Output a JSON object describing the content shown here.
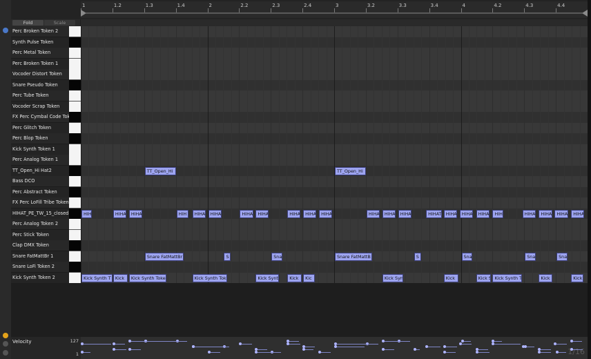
{
  "ruler": {
    "labels": [
      "1",
      "1.2",
      "1.3",
      "1.4",
      "2",
      "2.2",
      "2.3",
      "2.4",
      "3",
      "3.2",
      "3.3",
      "3.4",
      "4",
      "4.2",
      "4.3",
      "4.4"
    ]
  },
  "controls": {
    "fold_label": "Fold",
    "scale_label": "Scale"
  },
  "tracks": [
    "Perc Broken Token 2",
    "Synth Pulse Token",
    "Perc Metal Token",
    "Perc Broken Token 1",
    "Vocoder Distort Token",
    "Snare Pseudo Token",
    "Perc Tube Token",
    "Vocoder Scrap Token",
    "FX Perc Cymbal Code Toke",
    "Perc Glitch Token",
    "Perc Blop Token",
    "Kick Synth Token 1",
    "Perc Analog Token 1",
    "TT_Open_Hi Hat2",
    "Bass DCO",
    "Perc Abstract Token",
    "FX Perc LoFill Tribe Token",
    "HIHAT_PE_TW_15_closed",
    "Perc Analog Token 2",
    "Perc Stick Token",
    "Clap DMX Token",
    "Snare FatMattBr 1",
    "Snare LoFi Token 2",
    "Kick Synth Token 2"
  ],
  "notes": [
    {
      "row": 13,
      "start": 1.5,
      "len": 0.25,
      "label": "TT_Open_Hi"
    },
    {
      "row": 13,
      "start": 3.0,
      "len": 0.25,
      "label": "TT_Open_Hi"
    },
    {
      "row": 17,
      "start": 1.0,
      "len": 0.0875,
      "label": "HIH"
    },
    {
      "row": 17,
      "start": 1.25,
      "len": 0.11,
      "label": "HIHA"
    },
    {
      "row": 17,
      "start": 1.375,
      "len": 0.11,
      "label": "HIHA"
    },
    {
      "row": 17,
      "start": 1.75,
      "len": 0.1,
      "label": "HIH"
    },
    {
      "row": 17,
      "start": 1.875,
      "len": 0.11,
      "label": "HIHA"
    },
    {
      "row": 17,
      "start": 2.0,
      "len": 0.11,
      "label": "HIHA"
    },
    {
      "row": 17,
      "start": 2.25,
      "len": 0.11,
      "label": "HIHA"
    },
    {
      "row": 17,
      "start": 2.375,
      "len": 0.11,
      "label": "HIHA"
    },
    {
      "row": 17,
      "start": 2.625,
      "len": 0.11,
      "label": "HIHA"
    },
    {
      "row": 17,
      "start": 2.75,
      "len": 0.11,
      "label": "HIHA"
    },
    {
      "row": 17,
      "start": 2.875,
      "len": 0.11,
      "label": "HIHA"
    },
    {
      "row": 17,
      "start": 3.25,
      "len": 0.11,
      "label": "HIHA"
    },
    {
      "row": 17,
      "start": 3.375,
      "len": 0.11,
      "label": "HIHA"
    },
    {
      "row": 17,
      "start": 3.5,
      "len": 0.11,
      "label": "HIHA"
    },
    {
      "row": 17,
      "start": 3.72,
      "len": 0.13,
      "label": "HIHAT"
    },
    {
      "row": 17,
      "start": 3.86,
      "len": 0.11,
      "label": "HIHA"
    },
    {
      "row": 17,
      "start": 3.985,
      "len": 0.11,
      "label": "HIHA"
    },
    {
      "row": 17,
      "start": 4.115,
      "len": 0.11,
      "label": "HIHA"
    },
    {
      "row": 17,
      "start": 4.245,
      "len": 0.09,
      "label": "HIH"
    },
    {
      "row": 17,
      "start": 4.48,
      "len": 0.11,
      "label": "HIHA"
    },
    {
      "row": 17,
      "start": 4.61,
      "len": 0.11,
      "label": "HIHA"
    },
    {
      "row": 17,
      "start": 4.735,
      "len": 0.11,
      "label": "HIHA"
    },
    {
      "row": 17,
      "start": 4.865,
      "len": 0.11,
      "label": "HIHA"
    },
    {
      "row": 21,
      "start": 1.5,
      "len": 0.31,
      "label": "Snare FatMattBr"
    },
    {
      "row": 21,
      "start": 2.125,
      "len": 0.06,
      "label": "S"
    },
    {
      "row": 21,
      "start": 2.5,
      "len": 0.09,
      "label": "Sna"
    },
    {
      "row": 21,
      "start": 3.0,
      "len": 0.3,
      "label": "Snare FatMattB"
    },
    {
      "row": 21,
      "start": 3.625,
      "len": 0.06,
      "label": "S"
    },
    {
      "row": 21,
      "start": 4.0,
      "len": 0.09,
      "label": "Sna"
    },
    {
      "row": 21,
      "start": 4.5,
      "len": 0.09,
      "label": "Sna"
    },
    {
      "row": 21,
      "start": 4.75,
      "len": 0.09,
      "label": "Sna"
    },
    {
      "row": 23,
      "start": 1.0,
      "len": 0.25,
      "label": "Kick Synth T"
    },
    {
      "row": 23,
      "start": 1.25,
      "len": 0.12,
      "label": "Kick"
    },
    {
      "row": 23,
      "start": 1.375,
      "len": 0.3,
      "label": "Kick Synth Toke"
    },
    {
      "row": 23,
      "start": 1.875,
      "len": 0.28,
      "label": "Kick Synth Tok"
    },
    {
      "row": 23,
      "start": 2.375,
      "len": 0.19,
      "label": "Kick Synt"
    },
    {
      "row": 23,
      "start": 2.625,
      "len": 0.12,
      "label": "Kick"
    },
    {
      "row": 23,
      "start": 2.75,
      "len": 0.1,
      "label": "Kic"
    },
    {
      "row": 23,
      "start": 3.375,
      "len": 0.17,
      "label": "Kick Syn"
    },
    {
      "row": 23,
      "start": 3.86,
      "len": 0.12,
      "label": "Kick"
    },
    {
      "row": 23,
      "start": 4.115,
      "len": 0.12,
      "label": "Kick S"
    },
    {
      "row": 23,
      "start": 4.245,
      "len": 0.24,
      "label": "Kick Synth T"
    },
    {
      "row": 23,
      "start": 4.61,
      "len": 0.11,
      "label": "Kick"
    },
    {
      "row": 23,
      "start": 4.865,
      "len": 0.1,
      "label": "Kick"
    }
  ],
  "velocity": {
    "label": "Velocity",
    "max_label": "127",
    "min_label": "1",
    "corner_label": "1/16"
  },
  "colors": {
    "note": "#9da4f0",
    "background": "#1e1e1e",
    "grid": "#373737"
  }
}
